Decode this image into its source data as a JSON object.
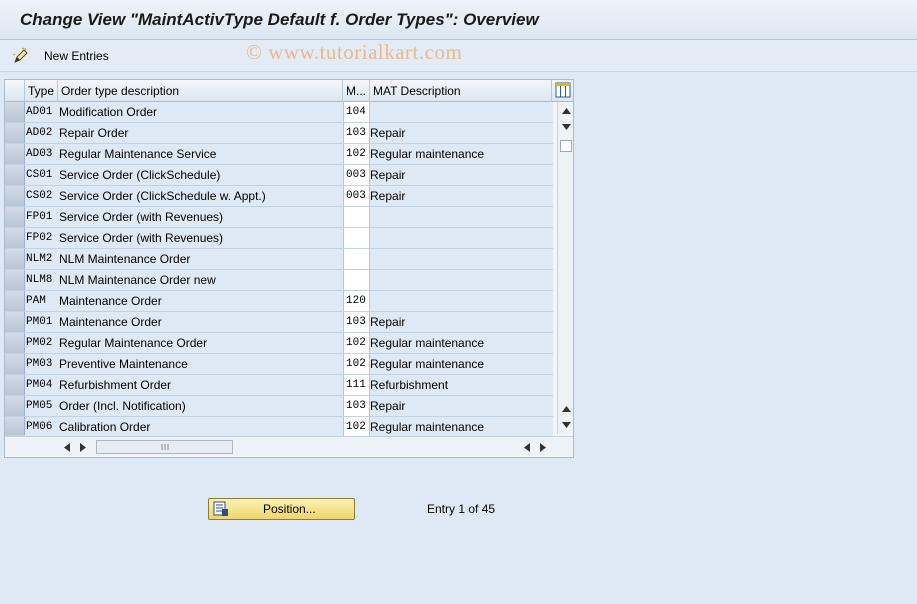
{
  "title": "Change View \"MaintActivType Default f. Order Types\": Overview",
  "toolbar": {
    "new_entries_label": "New Entries"
  },
  "watermark": "© www.tutorialkart.com",
  "table": {
    "headers": {
      "type": "Type",
      "desc": "Order type description",
      "m": "M...",
      "mat": "MAT Description"
    },
    "rows": [
      {
        "type": "AD01",
        "desc": "Modification Order",
        "m": "104",
        "mat": ""
      },
      {
        "type": "AD02",
        "desc": "Repair Order",
        "m": "103",
        "mat": "Repair"
      },
      {
        "type": "AD03",
        "desc": "Regular Maintenance Service",
        "m": "102",
        "mat": "Regular maintenance"
      },
      {
        "type": "CS01",
        "desc": "Service Order (ClickSchedule)",
        "m": "003",
        "mat": "Repair"
      },
      {
        "type": "CS02",
        "desc": "Service Order (ClickSchedule w. Appt.)",
        "m": "003",
        "mat": "Repair"
      },
      {
        "type": "FP01",
        "desc": "Service Order (with Revenues)",
        "m": "",
        "mat": ""
      },
      {
        "type": "FP02",
        "desc": "Service Order (with Revenues)",
        "m": "",
        "mat": ""
      },
      {
        "type": "NLM2",
        "desc": "NLM Maintenance Order",
        "m": "",
        "mat": ""
      },
      {
        "type": "NLM8",
        "desc": "NLM Maintenance Order new",
        "m": "",
        "mat": ""
      },
      {
        "type": "PAM",
        "desc": "Maintenance Order",
        "m": "120",
        "mat": ""
      },
      {
        "type": "PM01",
        "desc": "Maintenance Order",
        "m": "103",
        "mat": "Repair"
      },
      {
        "type": "PM02",
        "desc": "Regular Maintenance Order",
        "m": "102",
        "mat": "Regular maintenance"
      },
      {
        "type": "PM03",
        "desc": "Preventive Maintenance",
        "m": "102",
        "mat": "Regular maintenance"
      },
      {
        "type": "PM04",
        "desc": "Refurbishment Order",
        "m": "111",
        "mat": "Refurbishment"
      },
      {
        "type": "PM05",
        "desc": "Order (Incl. Notification)",
        "m": "103",
        "mat": "Repair"
      },
      {
        "type": "PM06",
        "desc": "Calibration Order",
        "m": "102",
        "mat": "Regular maintenance"
      }
    ]
  },
  "position_label": "Position...",
  "entry_info": "Entry 1 of 45"
}
